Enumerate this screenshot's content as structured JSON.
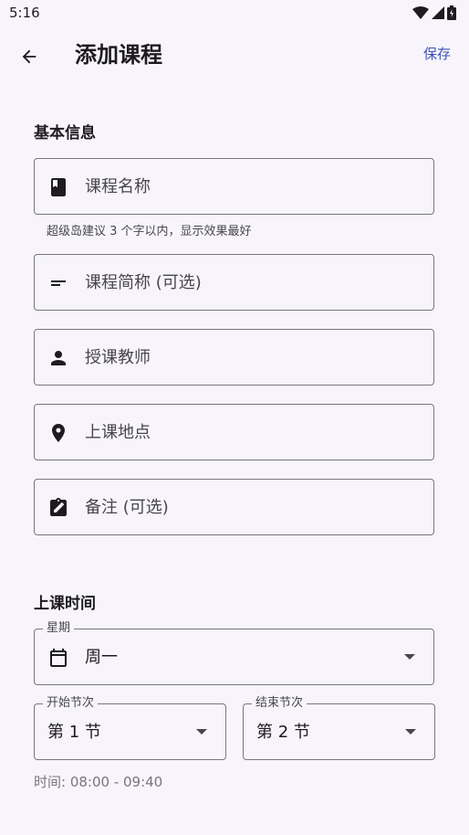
{
  "status": {
    "time": "5:16"
  },
  "appbar": {
    "title": "添加课程",
    "save": "保存"
  },
  "basic": {
    "title": "基本信息",
    "course_name": "课程名称",
    "helper": "超级岛建议 3 个字以内，显示效果最好",
    "short_name": "课程简称 (可选)",
    "teacher": "授课教师",
    "location": "上课地点",
    "note": "备注 (可选)"
  },
  "schedule": {
    "title": "上课时间",
    "weekday_label": "星期",
    "weekday_value": "周一",
    "start_label": "开始节次",
    "start_value": "第 1 节",
    "end_label": "结束节次",
    "end_value": "第 2 节",
    "time_text": "时间: 08:00 - 09:40"
  },
  "icons": {
    "back": "arrow-back-icon",
    "name": "book-icon",
    "short": "short-text-icon",
    "teacher": "person-icon",
    "location": "location-pin-icon",
    "note": "edit-clipboard-icon",
    "weekday": "calendar-icon",
    "dropdown": "dropdown-arrow-icon"
  },
  "colors": {
    "accent": "#3f51b5",
    "background": "#f7f5fb",
    "outline": "#79747e"
  }
}
